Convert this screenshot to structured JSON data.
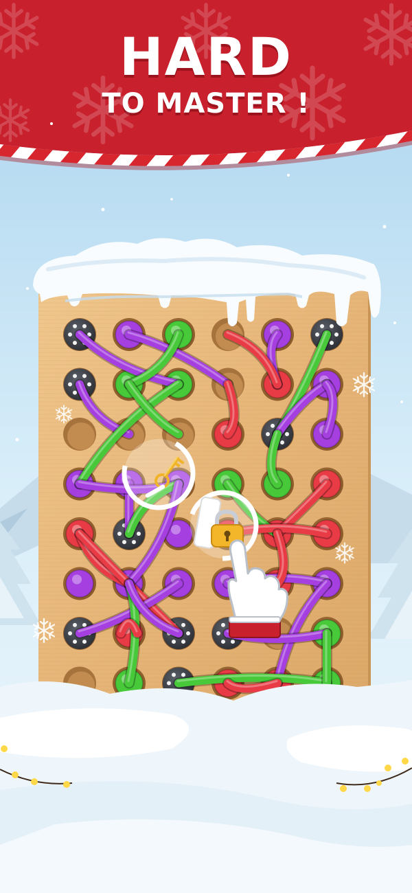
{
  "banner": {
    "line1": "HARD",
    "line2": "TO MASTER !",
    "bg_color": "#c8202c",
    "stripe_colors": [
      "#ffffff",
      "#d8262e"
    ]
  },
  "scene": {
    "sky_colors": [
      "#b7dcf1",
      "#e9f5fb"
    ],
    "snow_color": "#f6fbff"
  },
  "board": {
    "wood_color": "#e8b87a",
    "rows": 8,
    "cols": 6,
    "holes": [
      [
        "screw",
        "pin",
        "pin",
        "empty",
        "pin",
        "screw"
      ],
      [
        "screw",
        "pin",
        "pin",
        "empty",
        "pin",
        "pin"
      ],
      [
        "empty",
        "empty",
        "empty",
        "pin",
        "screw",
        "pin"
      ],
      [
        "pin",
        "pin",
        "pin",
        "pin",
        "pin",
        "pin"
      ],
      [
        "pin",
        "screw",
        "pin",
        "pin",
        "pin",
        "pin"
      ],
      [
        "pin",
        "pin",
        "pin",
        "pin",
        "pin",
        "pin"
      ],
      [
        "screw",
        "pin",
        "screw",
        "screw",
        "empty",
        "pin"
      ],
      [
        "empty",
        "pin",
        "screw",
        "pin",
        "pin",
        "pin"
      ]
    ],
    "rope_colors": {
      "purple": "#a53fe0",
      "green": "#47c93a",
      "red": "#e83b46"
    },
    "ropes": [
      {
        "color": "purple",
        "from": [
          0,
          0
        ],
        "to": [
          1,
          2
        ]
      },
      {
        "color": "purple",
        "from": [
          0,
          1
        ],
        "to": [
          1,
          3
        ]
      },
      {
        "color": "green",
        "from": [
          0,
          2
        ],
        "to": [
          1,
          1
        ]
      },
      {
        "color": "purple",
        "from": [
          0,
          4
        ],
        "to": [
          1,
          4
        ]
      },
      {
        "color": "green",
        "from": [
          0,
          5
        ],
        "to": [
          2,
          4
        ]
      },
      {
        "color": "red",
        "from": [
          0,
          3
        ],
        "to": [
          1,
          4
        ]
      },
      {
        "color": "purple",
        "from": [
          1,
          0
        ],
        "to": [
          2,
          1
        ]
      },
      {
        "color": "purple",
        "from": [
          1,
          5
        ],
        "to": [
          2,
          4
        ]
      },
      {
        "color": "red",
        "from": [
          1,
          3
        ],
        "to": [
          2,
          3
        ]
      },
      {
        "color": "green",
        "from": [
          1,
          2
        ],
        "to": [
          3,
          0
        ]
      },
      {
        "color": "green",
        "from": [
          1,
          1
        ],
        "to": [
          2,
          2
        ]
      },
      {
        "color": "purple",
        "from": [
          2,
          5
        ],
        "to": [
          1,
          5
        ]
      },
      {
        "color": "green",
        "from": [
          2,
          4
        ],
        "to": [
          3,
          4
        ]
      },
      {
        "color": "purple",
        "from": [
          3,
          1
        ],
        "to": [
          4,
          1
        ]
      },
      {
        "color": "purple",
        "from": [
          3,
          0
        ],
        "to": [
          3,
          2
        ]
      },
      {
        "color": "green",
        "from": [
          3,
          2
        ],
        "to": [
          4,
          1
        ]
      },
      {
        "color": "green",
        "from": [
          3,
          3
        ],
        "to": [
          4,
          4
        ]
      },
      {
        "color": "red",
        "from": [
          3,
          5
        ],
        "to": [
          4,
          4
        ]
      },
      {
        "color": "red",
        "from": [
          4,
          0
        ],
        "to": [
          5,
          1
        ]
      },
      {
        "color": "red",
        "from": [
          4,
          3
        ],
        "to": [
          4,
          5
        ]
      },
      {
        "color": "purple",
        "from": [
          3,
          2
        ],
        "to": [
          5,
          1
        ]
      },
      {
        "color": "red",
        "from": [
          4,
          0
        ],
        "to": [
          6,
          2
        ]
      },
      {
        "color": "purple",
        "from": [
          5,
          2
        ],
        "to": [
          6,
          0
        ]
      },
      {
        "color": "green",
        "from": [
          5,
          1
        ],
        "to": [
          7,
          1
        ]
      },
      {
        "color": "purple",
        "from": [
          5,
          1
        ],
        "to": [
          6,
          2
        ]
      },
      {
        "color": "purple",
        "from": [
          5,
          3
        ],
        "to": [
          5,
          5
        ]
      },
      {
        "color": "red",
        "from": [
          4,
          4
        ],
        "to": [
          5,
          4
        ]
      },
      {
        "color": "purple",
        "from": [
          5,
          5
        ],
        "to": [
          7,
          4
        ]
      },
      {
        "color": "purple",
        "from": [
          6,
          3
        ],
        "to": [
          6,
          5
        ]
      },
      {
        "color": "green",
        "from": [
          7,
          2
        ],
        "to": [
          7,
          5
        ]
      },
      {
        "color": "red",
        "from": [
          7,
          3
        ],
        "to": [
          7,
          4
        ]
      },
      {
        "color": "green",
        "from": [
          6,
          5
        ],
        "to": [
          7,
          5
        ]
      },
      {
        "color": "red",
        "from": [
          6,
          1
        ],
        "to": [
          6,
          1
        ]
      }
    ]
  },
  "items": {
    "key_color": "#f0b42a",
    "lock_color": "#f3b52a"
  },
  "icons": {
    "tutorial_hand": "pointing-hand-icon",
    "key": "key-icon",
    "lock": "padlock-icon",
    "snowflake": "snowflake-icon"
  }
}
